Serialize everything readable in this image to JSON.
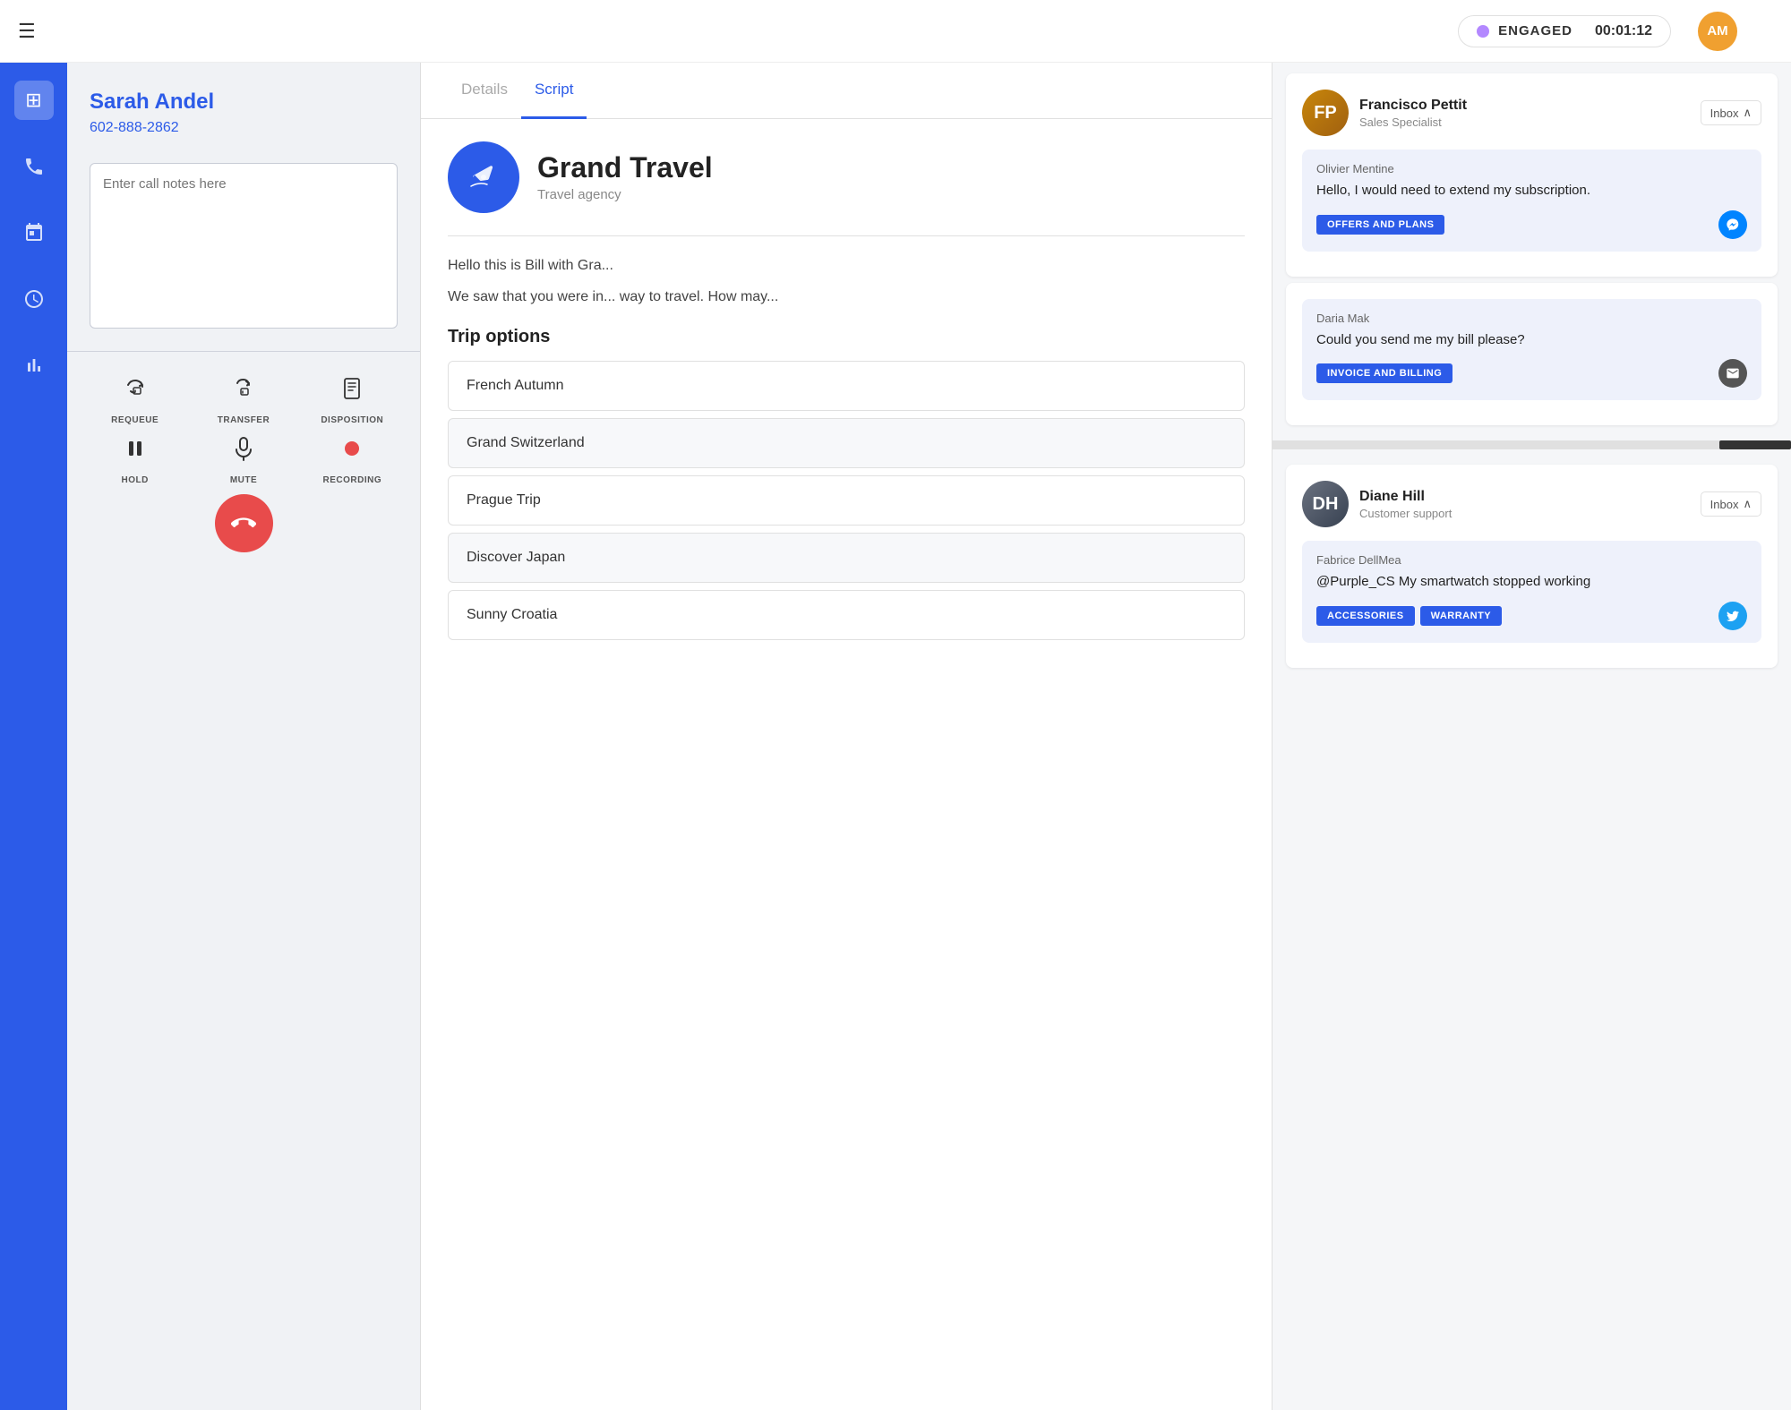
{
  "topbar": {
    "hamburger_icon": "☰",
    "status": "ENGAGED",
    "timer": "00:01:12",
    "avatar_initials": "AM",
    "status_dot_color": "#b388ff"
  },
  "nav": {
    "icons": [
      {
        "name": "dialpad-icon",
        "symbol": "⊞",
        "active": true
      },
      {
        "name": "phone-icon",
        "symbol": "✆",
        "active": false
      },
      {
        "name": "calendar-icon",
        "symbol": "📋",
        "active": false
      },
      {
        "name": "clock-icon",
        "symbol": "⏱",
        "active": false
      },
      {
        "name": "chart-icon",
        "symbol": "📊",
        "active": false
      }
    ]
  },
  "caller": {
    "name": "Sarah Andel",
    "phone": "602-888-2862"
  },
  "notes": {
    "placeholder": "Enter call notes here"
  },
  "tabs": [
    {
      "label": "Details",
      "active": false
    },
    {
      "label": "Script",
      "active": true
    }
  ],
  "company": {
    "name": "Grand Travel",
    "type": "Travel agency",
    "logo_icon": "✈"
  },
  "script": {
    "line1": "Hello this is Bill with Gra...",
    "line2": "We saw that you were in... way to travel. How may..."
  },
  "trip_options": {
    "title": "Trip options",
    "items": [
      {
        "name": "French Autumn"
      },
      {
        "name": "Grand Switzerland"
      },
      {
        "name": "Prague Trip"
      },
      {
        "name": "Discover Japan"
      },
      {
        "name": "Sunny Croatia"
      }
    ]
  },
  "actions": {
    "requeue": {
      "label": "REQUEUE",
      "icon": "↺☎"
    },
    "transfer": {
      "label": "TRANSFER",
      "icon": "↗☎"
    },
    "disposition": {
      "label": "DISPOSITION",
      "icon": "📋"
    },
    "hold": {
      "label": "HOLD",
      "icon": "⏸"
    },
    "mute": {
      "label": "MUTE",
      "icon": "🎤"
    },
    "recording": {
      "label": "RECORDING",
      "icon": "⏺"
    },
    "end_call_icon": "📞"
  },
  "chat": {
    "cards": [
      {
        "agent_name": "Francisco Pettit",
        "agent_role": "Sales Specialist",
        "inbox_label": "Inbox",
        "sender": "Olivier Mentine",
        "message": "Hello, I would need to extend my subscription.",
        "tag": "OFFERS AND PLANS",
        "channel": "messenger"
      },
      {
        "agent_name": "Francisco Pettit",
        "agent_role": "Sales Specialist",
        "sender": "Daria Mak",
        "message": "Could you send me my bill please?",
        "tag": "INVOICE AND BILLING",
        "channel": "email"
      },
      {
        "agent_name": "Diane Hill",
        "agent_role": "Customer support",
        "inbox_label": "Inbox",
        "sender": "Fabrice DellMea",
        "message": "@Purple_CS My smartwatch stopped working",
        "tags": [
          "ACCESSORIES",
          "WARRANTY"
        ],
        "channel": "twitter"
      }
    ]
  }
}
